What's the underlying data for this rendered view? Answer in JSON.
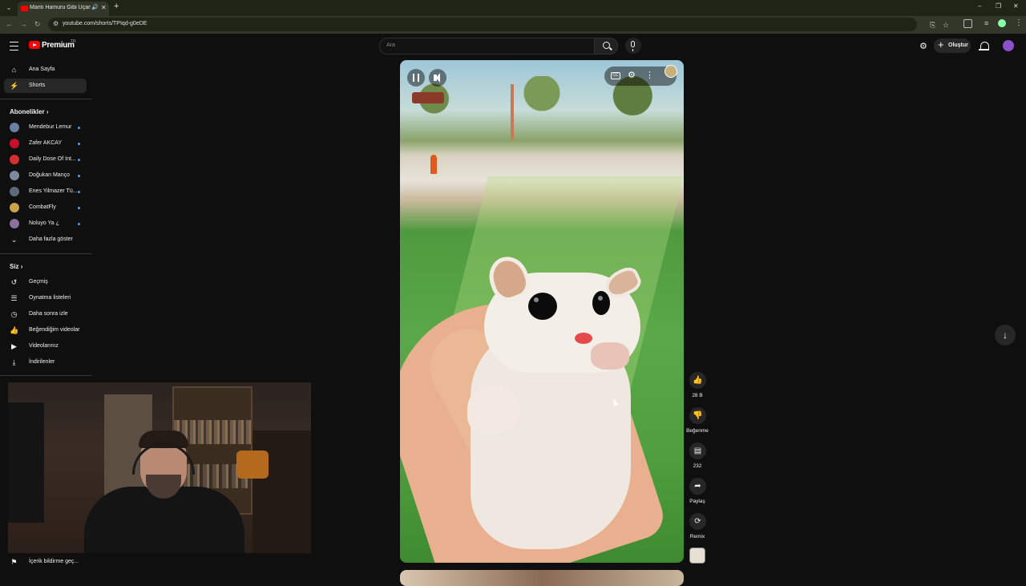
{
  "browser": {
    "tab_title": "Mantı Hamuru Gibi Uçan K",
    "url": "youtube.com/shorts/TPIqd-g0eDE",
    "icons": [
      "tab-search-icon",
      "audio-icon",
      "close-icon",
      "new-tab-icon",
      "back-icon",
      "forward-icon",
      "reload-icon",
      "site-info-icon",
      "install-icon",
      "bookmark-star-icon",
      "extensions-icon",
      "profile-icon",
      "menu-icon"
    ]
  },
  "header": {
    "logo_text": "Premium",
    "logo_sup": "TR",
    "search_placeholder": "Ara",
    "create_label": "Oluştur"
  },
  "sidebar": {
    "main": [
      {
        "label": "Ana Sayfa",
        "icon": "home-icon"
      },
      {
        "label": "Shorts",
        "icon": "shorts-icon",
        "active": true
      }
    ],
    "subscriptions_title": "Abonelikler",
    "subscriptions": [
      {
        "label": "Mendebur Lemur",
        "color": "#6a7fa3"
      },
      {
        "label": "Zafer AKCAY",
        "color": "#c8102e"
      },
      {
        "label": "Daily Dose Of Int...",
        "color": "#d32f2f"
      },
      {
        "label": "Doğukan Manço",
        "color": "#7c8aa0"
      },
      {
        "label": "Enes Yilmazer Tü...",
        "color": "#5b6b7a"
      },
      {
        "label": "CombatFly",
        "color": "#c9a24a"
      },
      {
        "label": "Noluyo Ya ¿",
        "color": "#8b6f9c"
      }
    ],
    "show_more": "Daha fazla göster",
    "you_title": "Siz",
    "you": [
      {
        "label": "Geçmiş",
        "icon": "history-icon"
      },
      {
        "label": "Oynatma listeleri",
        "icon": "playlist-icon"
      },
      {
        "label": "Daha sonra izle",
        "icon": "clock-icon"
      },
      {
        "label": "Beğendiğim videolar",
        "icon": "thumbs-up-icon"
      },
      {
        "label": "Videolarınız",
        "icon": "your-videos-icon"
      },
      {
        "label": "İndirilenler",
        "icon": "download-icon"
      }
    ],
    "report": "İçerik bildirme geç..."
  },
  "actions": {
    "likes": "28 B",
    "dislike": "Beğenme",
    "comments": "232",
    "share": "Paylaş",
    "remix": "Remix"
  }
}
